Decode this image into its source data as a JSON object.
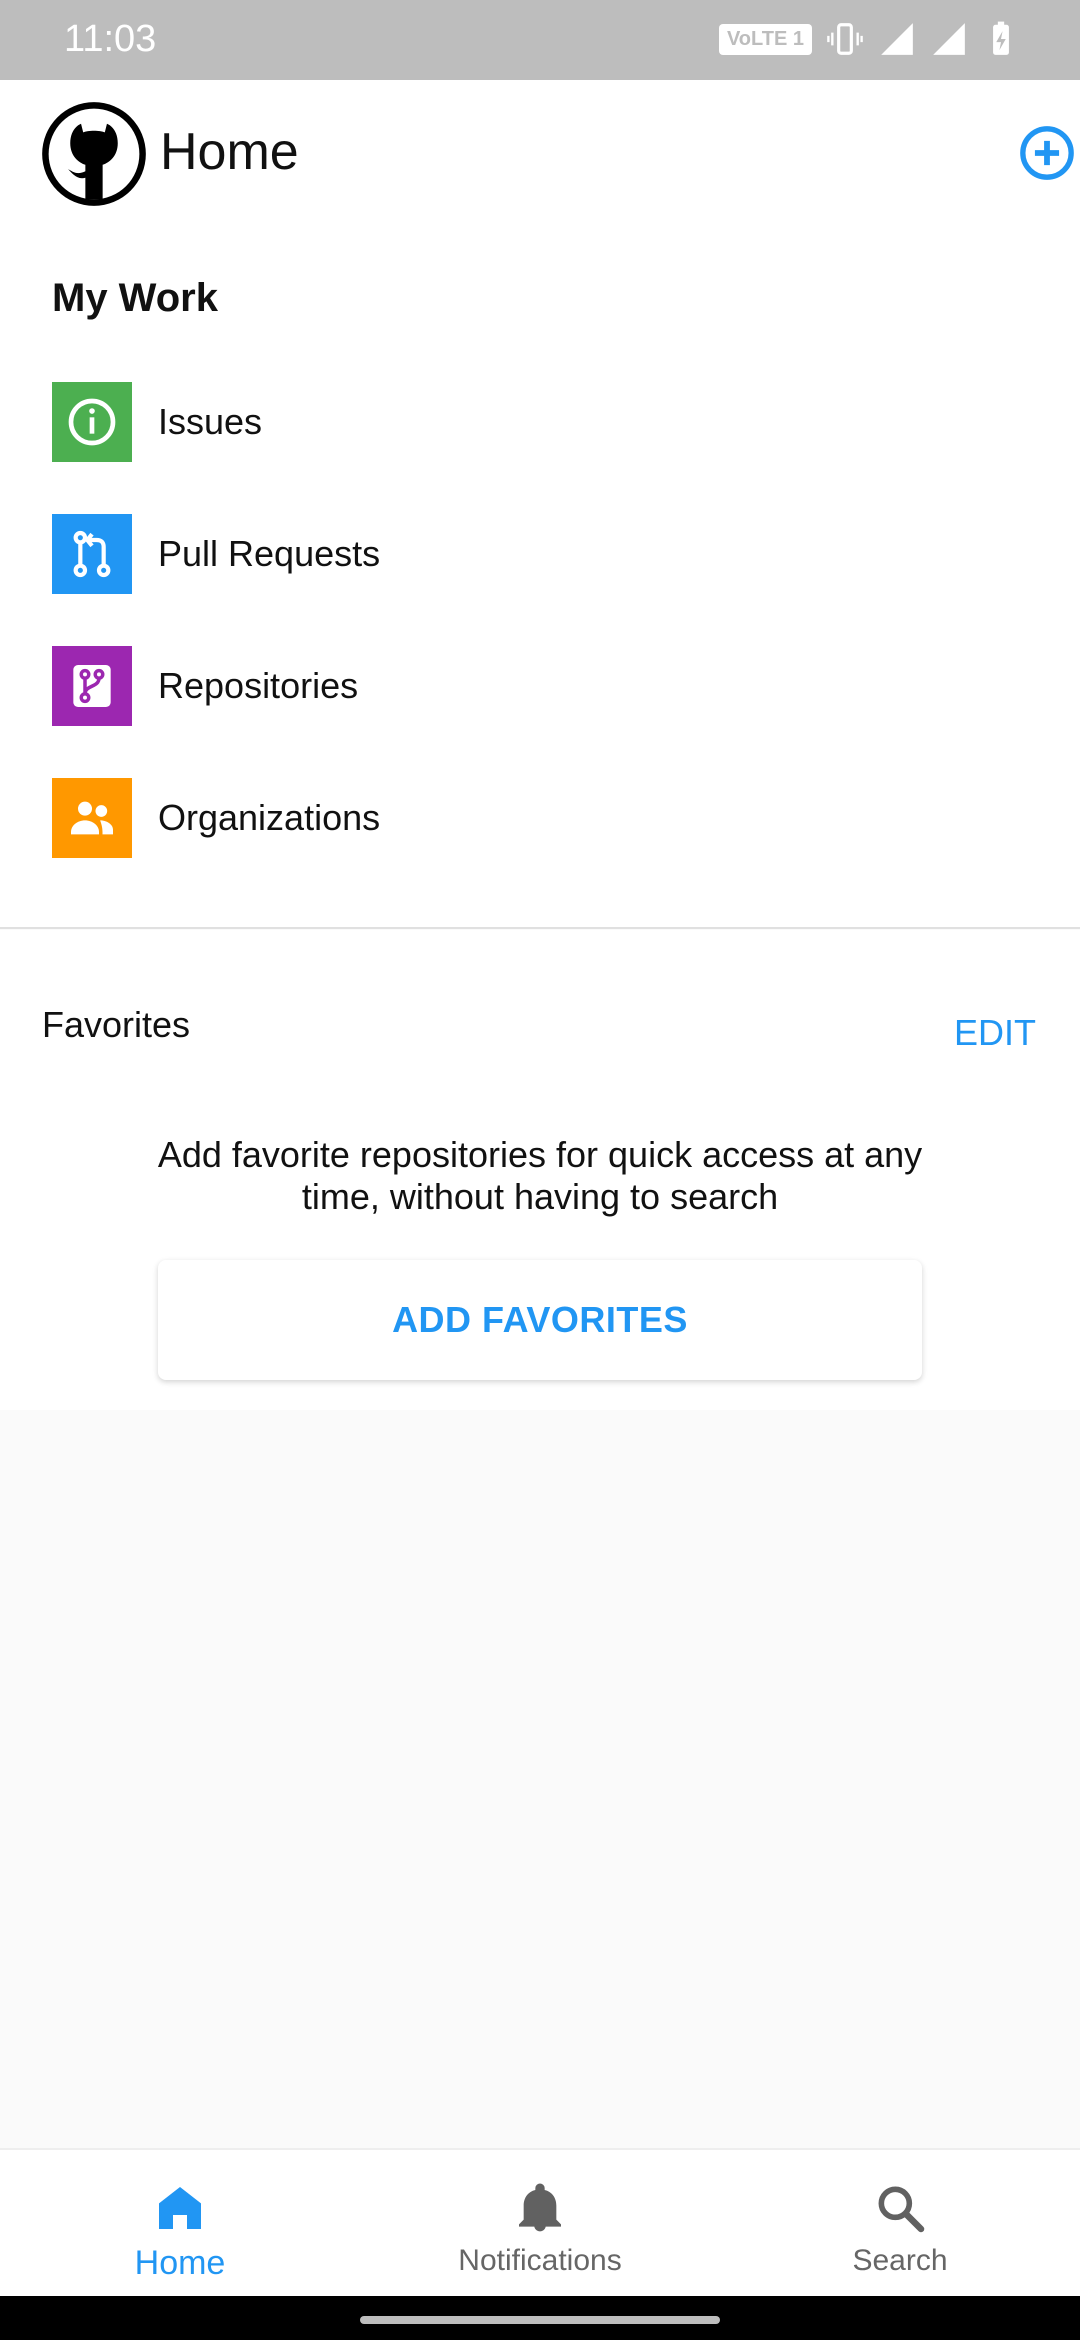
{
  "status_bar": {
    "time": "11:03",
    "volte": "VoLTE 1"
  },
  "header": {
    "title": "Home"
  },
  "my_work": {
    "title": "My Work",
    "items": [
      {
        "label": "Issues",
        "color": "#4caf50",
        "icon": "info-circle-icon"
      },
      {
        "label": "Pull Requests",
        "color": "#2196f3",
        "icon": "pull-request-icon"
      },
      {
        "label": "Repositories",
        "color": "#9c27b0",
        "icon": "repo-branch-icon"
      },
      {
        "label": "Organizations",
        "color": "#ff9800",
        "icon": "people-icon"
      }
    ]
  },
  "favorites": {
    "title": "Favorites",
    "edit_label": "EDIT",
    "description": "Add favorite repositories for quick access at any time, without having to search",
    "add_button_label": "ADD FAVORITES"
  },
  "bottom_nav": {
    "items": [
      {
        "label": "Home",
        "icon": "home-icon",
        "active": true
      },
      {
        "label": "Notifications",
        "icon": "bell-icon",
        "active": false
      },
      {
        "label": "Search",
        "icon": "search-icon",
        "active": false
      }
    ]
  },
  "colors": {
    "accent": "#2196f3"
  }
}
